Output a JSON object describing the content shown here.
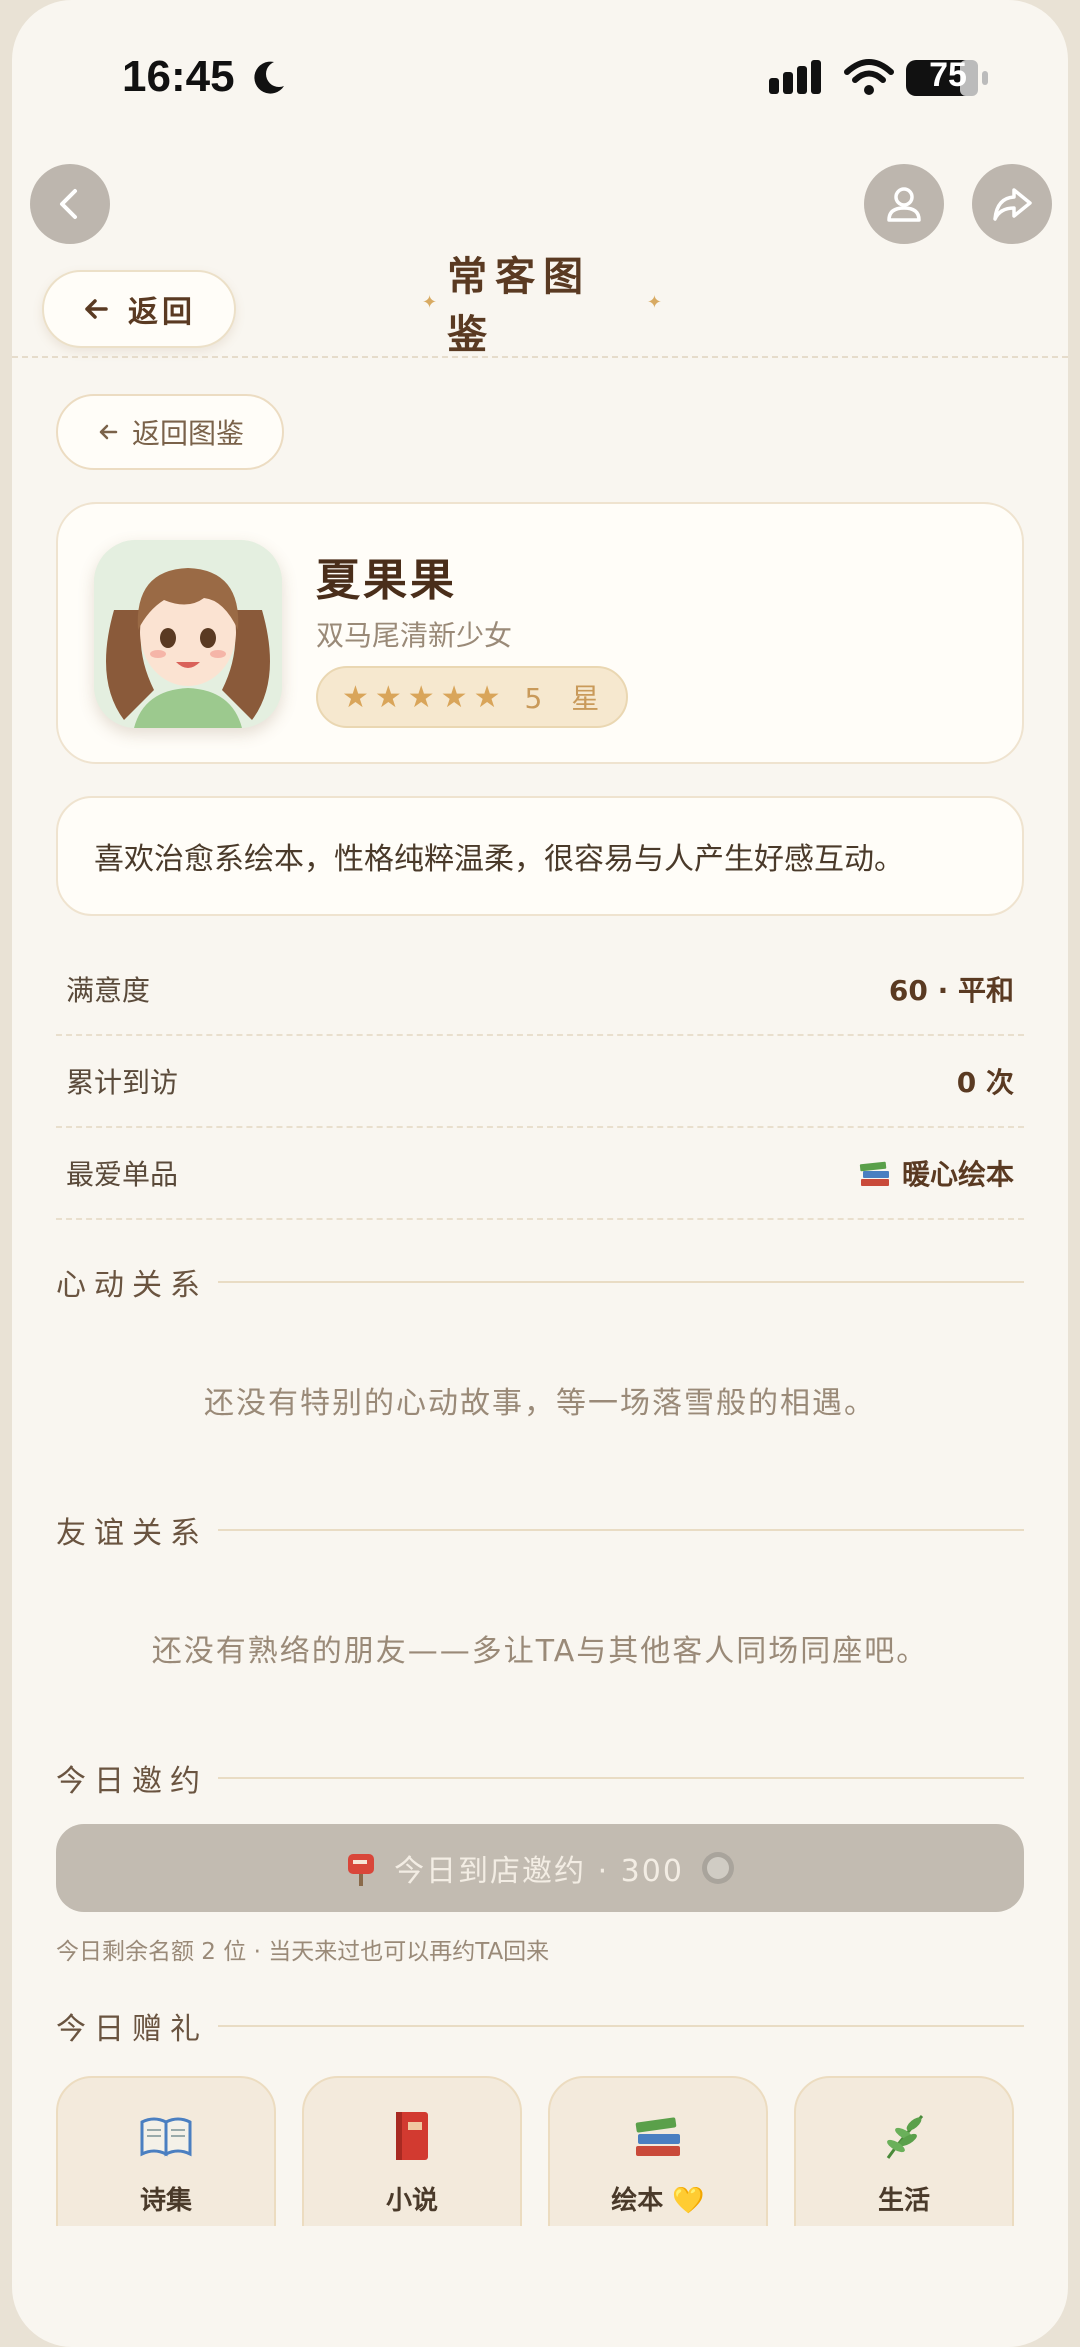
{
  "status": {
    "time": "16:45",
    "battery": "75"
  },
  "header": {
    "back_label": "返回",
    "title": "常客图鉴"
  },
  "back_gallery_label": "返回图鉴",
  "profile": {
    "name": "夏果果",
    "subtitle": "双马尾清新少女",
    "stars": "★★★★★",
    "star_count": "5 星",
    "description": "喜欢治愈系绘本，性格纯粹温柔，很容易与人产生好感互动。"
  },
  "stats": [
    {
      "label": "满意度",
      "value": "60 · 平和"
    },
    {
      "label": "累计到访",
      "value": "0 次"
    },
    {
      "label": "最爱单品",
      "value": "暖心绘本"
    }
  ],
  "sections": {
    "heart": {
      "title": "心动关系",
      "empty": "还没有特别的心动故事，等一场落雪般的相遇。"
    },
    "friend": {
      "title": "友谊关系",
      "empty": "还没有熟络的朋友——多让TA与其他客人同场同座吧。"
    },
    "invite": {
      "title": "今日邀约",
      "button": "今日到店邀约 · 300",
      "note": "今日剩余名额 2 位 · 当天来过也可以再约TA回来"
    },
    "gift": {
      "title": "今日赠礼"
    }
  },
  "gifts": [
    {
      "label": "诗集",
      "icon": "open-book-icon"
    },
    {
      "label": "小说",
      "icon": "red-book-icon"
    },
    {
      "label": "绘本 💛",
      "icon": "books-stack-icon"
    },
    {
      "label": "生活",
      "icon": "herb-icon"
    }
  ],
  "colors": {
    "background": "#f9f6f0",
    "accent": "#d9a55a",
    "text_dark": "#5a3a22",
    "invite_disabled": "#c2bbb1"
  }
}
